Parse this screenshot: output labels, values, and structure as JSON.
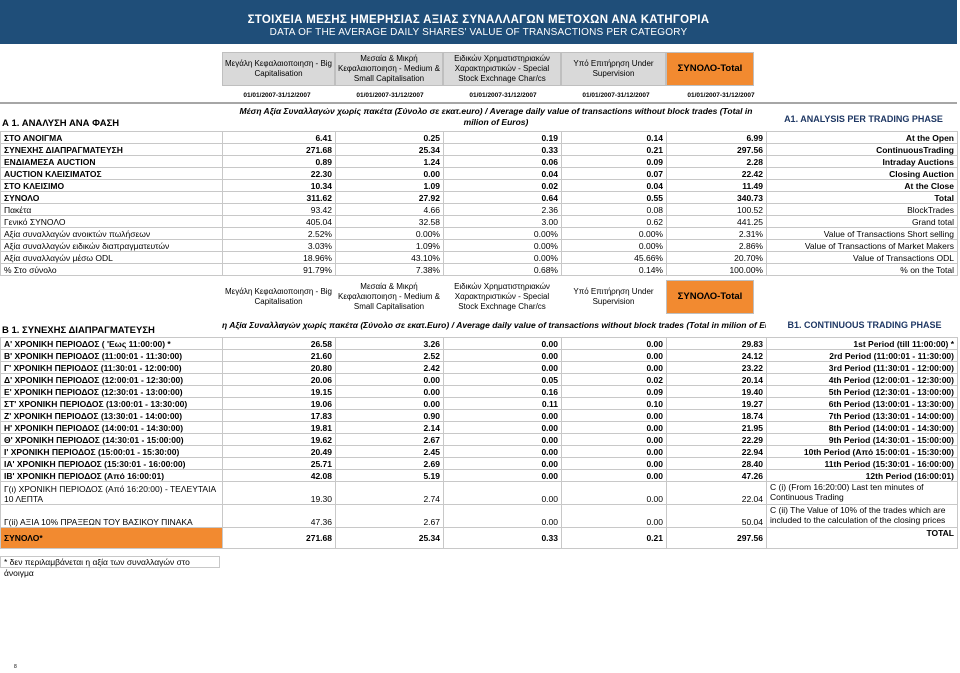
{
  "title": {
    "greek": "ΣΤΟΙΧΕΙΑ ΜΕΣΗΣ ΗΜΕΡΗΣΙΑΣ ΑΞΙΑΣ ΣΥΝΑΛΛΑΓΩΝ ΜΕΤΟΧΩΝ ΑΝΑ ΚΑΤΗΓΟΡΙΑ",
    "english": "DATA OF THE AVERAGE DAILY SHARES' VALUE OF TRANSACTIONS PER CATEGORY"
  },
  "columns": [
    "Μεγάλη Κεφαλαιοποιηση - Big Capitalisation",
    "Μεσαία & Μικρή Κεφαλαιοποιηση - Medium & Small Capitalisation",
    "Ειδικών Χρηματιστηριακών Χαρακτηριστικών - Special Stock Exchnage Char/cs",
    "Υπό Επιτήρηση Under Supervision",
    "ΣΥΝΟΛΟ-Total"
  ],
  "dates": [
    "01/01/2007-31/12/2007",
    "01/01/2007-31/12/2007",
    "01/01/2007-31/12/2007",
    "01/01/2007-31/12/2007",
    "01/01/2007-31/12/2007"
  ],
  "sectionA": {
    "title": "Α 1. ΑΝΑΛΥΣΗ ΑΝΑ ΦΑΣΗ",
    "subtitle": "Μέση Αξία Συναλλαγών χωρίς πακέτα (Σύνολο σε εκατ.euro) /  Average daily value of transactions without block trades (Total in milion of Euros)",
    "phase": "A1. ANALYSIS PER TRADING PHASE",
    "rows": [
      {
        "gr": "ΣΤΟ ΑΝΟΙΓΜΑ",
        "v": [
          "6.41",
          "0.25",
          "0.19",
          "0.14",
          "6.99"
        ],
        "en": "At the Open"
      },
      {
        "gr": "ΣΥΝΕΧΗΣ ΔΙΑΠΡΑΓΜΑΤΕΥΣΗ",
        "v": [
          "271.68",
          "25.34",
          "0.33",
          "0.21",
          "297.56"
        ],
        "en": "ContinuousTrading"
      },
      {
        "gr": "ΕΝΔΙΑΜΕΣΑ AUCTION",
        "v": [
          "0.89",
          "1.24",
          "0.06",
          "0.09",
          "2.28"
        ],
        "en": "Intraday Auctions"
      },
      {
        "gr": "AUCTION ΚΛΕΙΣΙΜΑΤΟΣ",
        "v": [
          "22.30",
          "0.00",
          "0.04",
          "0.07",
          "22.42"
        ],
        "en": "Closing Auction"
      },
      {
        "gr": "ΣΤΟ ΚΛΕΙΣΙΜΟ",
        "v": [
          "10.34",
          "1.09",
          "0.02",
          "0.04",
          "11.49"
        ],
        "en": "At the Close"
      },
      {
        "gr": "ΣΥΝΟΛΟ",
        "v": [
          "311.62",
          "27.92",
          "0.64",
          "0.55",
          "340.73"
        ],
        "en": "Total"
      },
      {
        "gr": "Πακέτα",
        "v": [
          "93.42",
          "4.66",
          "2.36",
          "0.08",
          "100.52"
        ],
        "en": "BlockTrades"
      },
      {
        "gr": "Γενικό ΣΥΝΟΛΟ",
        "v": [
          "405.04",
          "32.58",
          "3.00",
          "0.62",
          "441.25"
        ],
        "en": "Grand total"
      },
      {
        "gr": "Αξία συναλλαγών ανοικτών πωλήσεων",
        "v": [
          "2.52%",
          "0.00%",
          "0.00%",
          "0.00%",
          "2.31%"
        ],
        "en": "Value of Transactions Short selling"
      },
      {
        "gr": "Αξία συναλλαγών ειδικών διαπραγματευτών",
        "v": [
          "3.03%",
          "1.09%",
          "0.00%",
          "0.00%",
          "2.86%"
        ],
        "en": "Value of Transactions of Market Makers"
      },
      {
        "gr": "Αξία συναλλαγών μέσω ODL",
        "v": [
          "18.96%",
          "43.10%",
          "0.00%",
          "45.66%",
          "20.70%"
        ],
        "en": "Value of Transactions ODL"
      },
      {
        "gr": "% Στο σύνολο",
        "v": [
          "91.79%",
          "7.38%",
          "0.68%",
          "0.14%",
          "100.00%"
        ],
        "en": "% on the Total"
      }
    ]
  },
  "sectionB": {
    "title": "Β 1. ΣΥΝΕΧΗΣ ΔΙΑΠΡΑΓΜΑΤΕΥΣΗ",
    "subtitle": "η Αξία Συναλλαγών χωρίς πακέτα (Σύνολο σε εκατ.Euro) /  Average daily value of transactions without block trades (Total in milion of Eu",
    "phase": "B1. CONTINUOUS TRADING PHASE",
    "rows": [
      {
        "gr": "Α' ΧΡΟΝΙΚΗ ΠΕΡΙΟΔΟΣ ( 'Εως 11:00:00) *",
        "v": [
          "26.58",
          "3.26",
          "0.00",
          "0.00",
          "29.83"
        ],
        "en": "1st Period  (till 11:00:00) *"
      },
      {
        "gr": "Β' ΧΡΟΝΙΚΗ ΠΕΡΙΟΔΟΣ (11:00:01 - 11:30:00)",
        "v": [
          "21.60",
          "2.52",
          "0.00",
          "0.00",
          "24.12"
        ],
        "en": "2rd Period (11:00:01 - 11:30:00)"
      },
      {
        "gr": "Γ' ΧΡΟΝΙΚΗ ΠΕΡΙΟΔΟΣ (11:30:01 - 12:00:00)",
        "v": [
          "20.80",
          "2.42",
          "0.00",
          "0.00",
          "23.22"
        ],
        "en": "3rd Period (11:30:01 - 12:00:00)"
      },
      {
        "gr": "Δ' ΧΡΟΝΙΚΗ ΠΕΡΙΟΔΟΣ (12:00:01 - 12:30:00)",
        "v": [
          "20.06",
          "0.00",
          "0.05",
          "0.02",
          "20.14"
        ],
        "en": "4th Period (12:00:01 - 12:30:00)"
      },
      {
        "gr": "Ε' ΧΡΟΝΙΚΗ ΠΕΡΙΟΔΟΣ (12:30:01 - 13:00:00)",
        "v": [
          "19.15",
          "0.00",
          "0.16",
          "0.09",
          "19.40"
        ],
        "en": "5th Period (12:30:01 - 13:00:00)"
      },
      {
        "gr": "ΣΤ' ΧΡΟΝΙΚΗ ΠΕΡΙΟΔΟΣ (13:00:01 - 13:30:00)",
        "v": [
          "19.06",
          "0.00",
          "0.11",
          "0.10",
          "19.27"
        ],
        "en": "6th Period (13:00:01 - 13:30:00)"
      },
      {
        "gr": "Ζ' ΧΡΟΝΙΚΗ ΠΕΡΙΟΔΟΣ (13:30:01 - 14:00:00)",
        "v": [
          "17.83",
          "0.90",
          "0.00",
          "0.00",
          "18.74"
        ],
        "en": "7th Period (13:30:01 - 14:00:00)"
      },
      {
        "gr": "Η' ΧΡΟΝΙΚΗ ΠΕΡΙΟΔΟΣ (14:00:01 - 14:30:00)",
        "v": [
          "19.81",
          "2.14",
          "0.00",
          "0.00",
          "21.95"
        ],
        "en": "8th Period (14:00:01 - 14:30:00)"
      },
      {
        "gr": "Θ' ΧΡΟΝΙΚΗ ΠΕΡΙΟΔΟΣ (14:30:01 - 15:00:00)",
        "v": [
          "19.62",
          "2.67",
          "0.00",
          "0.00",
          "22.29"
        ],
        "en": "9th Period (14:30:01 - 15:00:00)"
      },
      {
        "gr": "Ι' ΧΡΟΝΙΚΗ ΠΕΡΙΟΔΟΣ (15:00:01 - 15:30:00)",
        "v": [
          "20.49",
          "2.45",
          "0.00",
          "0.00",
          "22.94"
        ],
        "en": "10th Period (Από 15:00:01 - 15:30:00)"
      },
      {
        "gr": "ΙΑ' ΧΡΟΝΙΚΗ ΠΕΡΙΟΔΟΣ (15:30:01 - 16:00:00)",
        "v": [
          "25.71",
          "2.69",
          "0.00",
          "0.00",
          "28.40"
        ],
        "en": "11th Period (15:30:01 - 16:00:00)"
      },
      {
        "gr": "ΙΒ' ΧΡΟΝΙΚΗ ΠΕΡΙΟΔΟΣ (Από 16:00:01)",
        "v": [
          "42.08",
          "5.19",
          "0.00",
          "0.00",
          "47.26"
        ],
        "en": "12th Period (16:00:01)"
      }
    ],
    "tall_rows": [
      {
        "gr": "Γ(ι) ΧΡΟΝΙΚΗ ΠΕΡΙΟΔΟΣ (Από 16:20:00) - ΤΕΛΕΥΤΑΙΑ 10 ΛΕΠΤΑ",
        "v": [
          "19.30",
          "2.74",
          "0.00",
          "0.00",
          "22.04"
        ],
        "en": "C (i)  (From 16:20:00)  Last ten minutes of Continuous Trading"
      },
      {
        "gr": "Γ(ii) ΑΞΙΑ 10% ΠΡΑΞΕΩΝ ΤΟΥ ΒΑΣΙΚΟΥ ΠΙΝΑΚΑ",
        "v": [
          "47.36",
          "2.67",
          "0.00",
          "0.00",
          "50.04"
        ],
        "en": "C (ii) The Value of 10% of the trades which are included to the calculation of the closing prices"
      }
    ],
    "total_row": {
      "gr": "ΣΥΝΟΛΟ*",
      "v": [
        "271.68",
        "25.34",
        "0.33",
        "0.21",
        "297.56"
      ],
      "en": "TOTAL"
    }
  },
  "footnote": "* δεν περιλαμβάνεται η αξία των συναλλαγών στο άνοιγμα",
  "page_mark": "8"
}
